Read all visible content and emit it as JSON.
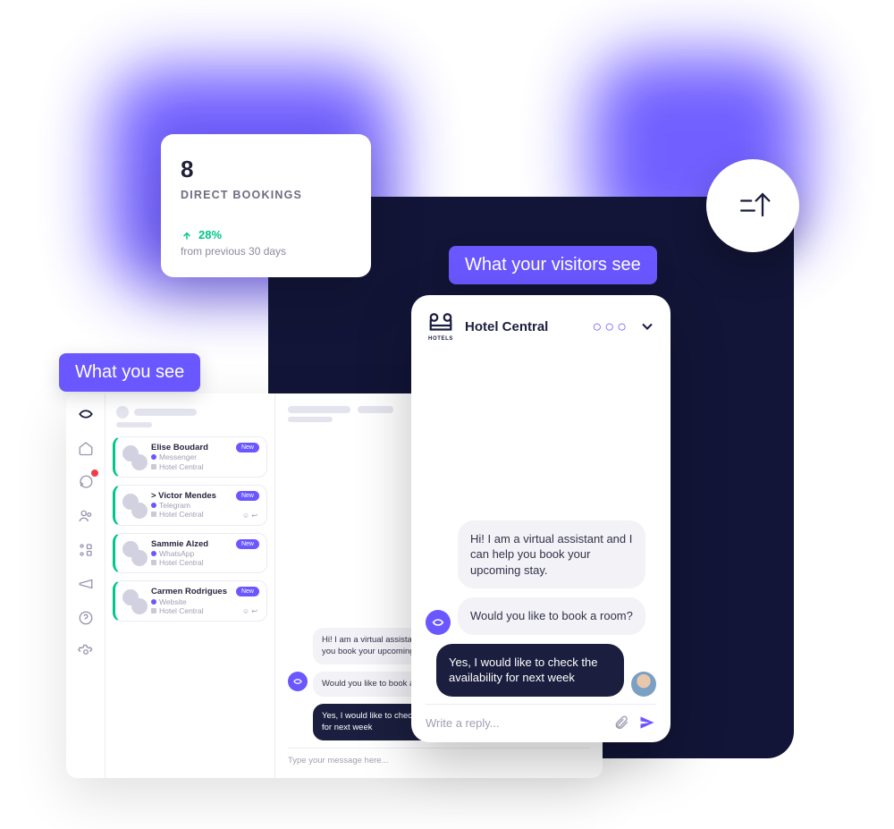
{
  "stat": {
    "value": "8",
    "title": "DIRECT BOOKINGS",
    "trend_pct": "28%",
    "trend_sub": "from previous 30 days"
  },
  "tags": {
    "you": "What you see",
    "visitors": "What your visitors see"
  },
  "dashboard": {
    "inbox": [
      {
        "name": "Elise Boudard",
        "channel": "Messenger",
        "brand": "Hotel Central",
        "badge": "New",
        "foot": ""
      },
      {
        "name": "> Victor Mendes",
        "channel": "Telegram",
        "brand": "Hotel Central",
        "badge": "New",
        "foot": "☺ ↩"
      },
      {
        "name": "Sammie Alzed",
        "channel": "WhatsApp",
        "brand": "Hotel Central",
        "badge": "New",
        "foot": ""
      },
      {
        "name": "Carmen Rodrigues",
        "channel": "Website",
        "brand": "Hotel Central",
        "badge": "New",
        "foot": "☺ ↩"
      }
    ],
    "conversation": {
      "bot1": "Hi! I am a virtual assistant and I can help you book your upcoming stay.",
      "bot2": "Would you like to book a room?",
      "user": "Yes, I would like to check the availability for next week",
      "placeholder": "Type your message here..."
    }
  },
  "chat": {
    "brand_caption": "HOTELS",
    "title": "Hotel Central",
    "bot1": "Hi! I am a virtual assistant and I can help you book your upcoming stay.",
    "bot2": "Would you like to book a room?",
    "user": "Yes, I would like to check the availability for next week",
    "placeholder": "Write a reply..."
  }
}
